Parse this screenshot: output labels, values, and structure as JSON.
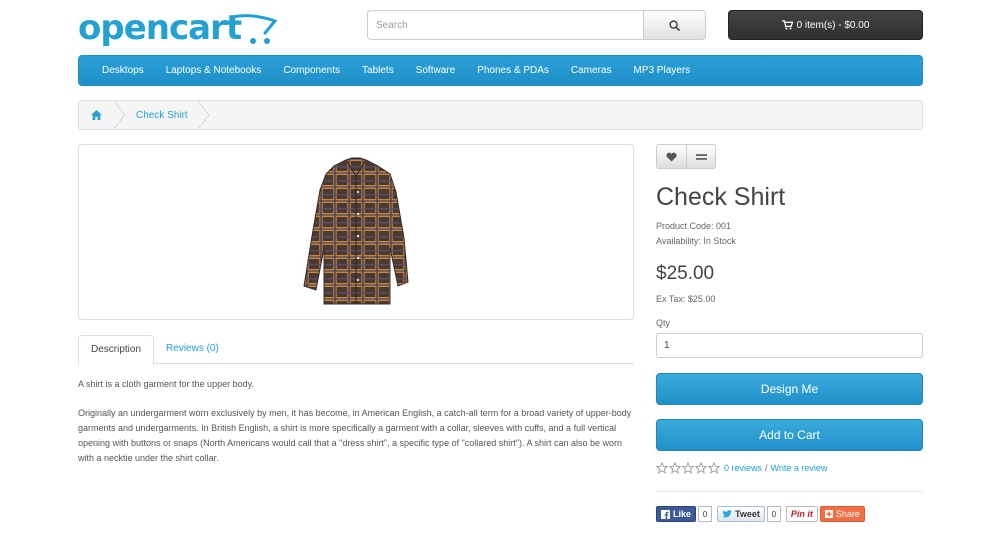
{
  "header": {
    "logo_text": "opencart",
    "search_placeholder": "Search",
    "cart_label": "0 item(s) - $0.00"
  },
  "menu": {
    "items": [
      {
        "label": "Desktops"
      },
      {
        "label": "Laptops & Notebooks"
      },
      {
        "label": "Components"
      },
      {
        "label": "Tablets"
      },
      {
        "label": "Software"
      },
      {
        "label": "Phones & PDAs"
      },
      {
        "label": "Cameras"
      },
      {
        "label": "MP3 Players"
      }
    ]
  },
  "breadcrumb": {
    "current": "Check Shirt"
  },
  "tabs": [
    {
      "label": "Description"
    },
    {
      "label": "Reviews (0)"
    }
  ],
  "description": {
    "p1": "A shirt is a cloth garment for the upper body.",
    "p2": "Originally an undergarment worn exclusively by men, it has become, in American English, a catch-all term for a broad variety of upper-body garments and undergarments. In British English, a shirt is more specifically a garment with a collar, sleeves with cuffs, and a full vertical opening with buttons or snaps (North Americans would call that a \"dress shirt\", a specific type of \"collared shirt\"). A shirt can also be worn with a necktie under the shirt collar."
  },
  "product": {
    "title": "Check Shirt",
    "code": "Product Code: 001",
    "availability": "Availability: In Stock",
    "price": "$25.00",
    "ex_tax": "Ex Tax: $25.00",
    "qty_label": "Qty",
    "qty_value": "1",
    "design_label": "Design Me",
    "add_to_cart_label": "Add to Cart",
    "rating_stars": 0,
    "reviews_link": "0 reviews",
    "review_sep": "/",
    "write_review_link": "Write a review"
  },
  "share": {
    "like_label": "Like",
    "like_count": "0",
    "tweet_label": "Tweet",
    "tweet_count": "0",
    "pin_label": "Pin it",
    "share_label": "Share"
  },
  "colors": {
    "brand": "#23a1d1",
    "menu_bg": "#229ac8",
    "cart_bg": "#363636"
  }
}
